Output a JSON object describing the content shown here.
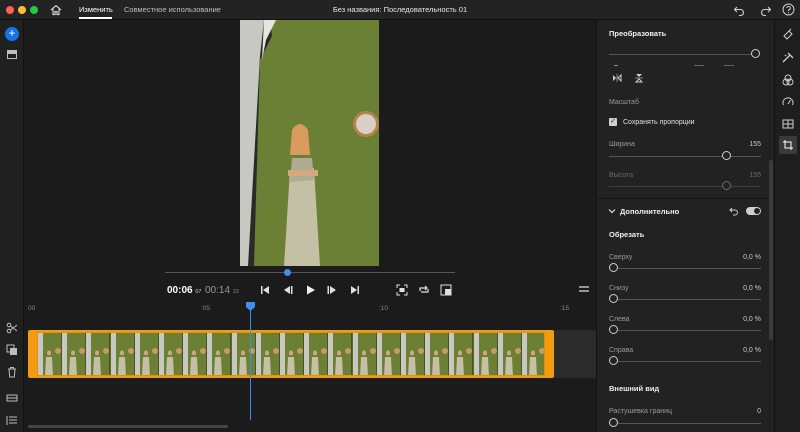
{
  "titlebar": {
    "tab_edit": "Изменить",
    "tab_share": "Совместное использование",
    "document_title": "Без названия: Последовательность 01"
  },
  "monitor": {
    "timecode_current": "00:06",
    "timecode_current_frames": "07",
    "timecode_total": "00:14",
    "timecode_total_frames": "22"
  },
  "timeline": {
    "ruler_labels": [
      "00",
      ":05",
      ":10",
      ":15"
    ]
  },
  "panel": {
    "transform_title": "Преобразовать",
    "scale_label": "Масштаб",
    "keep_proportions_label": "Сохранять пропорции",
    "width_label": "Ширина",
    "width_value": "155",
    "height_label": "Высота",
    "height_value": "155",
    "advanced_title": "Дополнительно",
    "crop_title": "Обрезать",
    "crop_top_label": "Сверху",
    "crop_top_value": "0,0 %",
    "crop_bottom_label": "Снизу",
    "crop_bottom_value": "0,0 %",
    "crop_left_label": "Слева",
    "crop_left_value": "0,0 %",
    "crop_right_label": "Справа",
    "crop_right_value": "0,0 %",
    "appearance_title": "Внешний вид",
    "feather_label": "Растушевка границ",
    "feather_value": "0"
  },
  "colors": {
    "accent": "#1473e6",
    "playhead": "#3d8df5",
    "clip": "#f39c12",
    "backdrop": "#6b7f35"
  },
  "icons": [
    "home-icon",
    "undo-icon",
    "redo-icon",
    "help-icon",
    "scissors-icon",
    "duplicate-icon",
    "trash-icon",
    "play-icon",
    "fullscreen-icon"
  ]
}
